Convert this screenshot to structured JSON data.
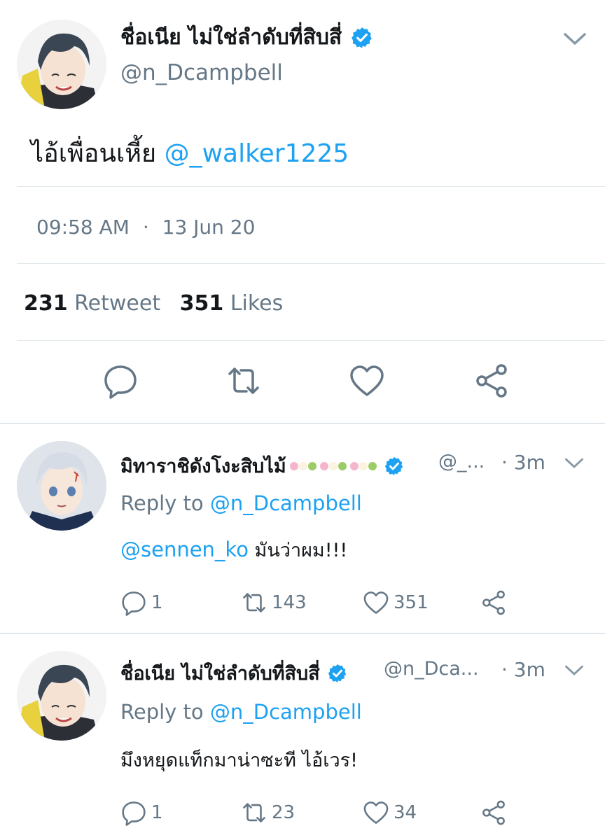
{
  "tweet": {
    "author_name": "ชื่อเนีย ไม่ใช่ลำดับที่สิบสี่",
    "author_handle": "@n_Dcampbell",
    "text_prefix": "ไอ้เพื่อนเหี้ย",
    "text_mention": "@_walker1225",
    "time": "09:58 AM",
    "separator": "·",
    "date": "13 Jun 20",
    "retweet_count": "231",
    "retweet_label": "Retweet",
    "like_count": "351",
    "like_label": "Likes"
  },
  "replies": [
    {
      "author_name": "มิทาราชิดังโงะสิบไม้",
      "author_handle": "@_...",
      "time": "· 3m",
      "reply_to_label": "Reply to",
      "reply_to_handle": "@n_Dcampbell",
      "text_mention": "@sennen_ko",
      "text": "มันว่าผม!!!",
      "reply_count": "1",
      "retweet_count": "143",
      "like_count": "351"
    },
    {
      "author_name": "ชื่อเนีย ไม่ใช่ลำดับที่สิบสี่",
      "author_handle": "@n_Dca...",
      "time": "· 3m",
      "reply_to_label": "Reply to",
      "reply_to_handle": "@n_Dcampbell",
      "text_mention": "",
      "text": "มึงหยุดแท็กมาน่าซะที ไอ้เวร!",
      "reply_count": "1",
      "retweet_count": "23",
      "like_count": "34"
    }
  ],
  "icons": {
    "verified": "verified-badge-icon",
    "chevron": "chevron-down-icon",
    "reply": "reply-icon",
    "retweet": "retweet-icon",
    "like": "heart-icon",
    "share": "share-icon"
  },
  "colors": {
    "accent": "#1da1f2",
    "muted": "#657786",
    "divider": "#e1e8ed",
    "text": "#14171a"
  }
}
